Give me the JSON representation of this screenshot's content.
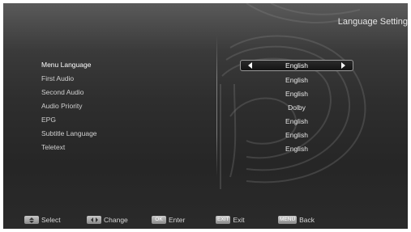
{
  "screen": {
    "title": "Language Setting"
  },
  "menu": {
    "items": [
      {
        "label": "Menu Language",
        "value": "English"
      },
      {
        "label": "First Audio",
        "value": "English"
      },
      {
        "label": "Second Audio",
        "value": "English"
      },
      {
        "label": "Audio Priority",
        "value": "Dolby"
      },
      {
        "label": "EPG",
        "value": "English"
      },
      {
        "label": "Subtitle Language",
        "value": "English"
      },
      {
        "label": "Teletext",
        "value": "English"
      }
    ],
    "selected_index": 0
  },
  "footer": {
    "select": {
      "label": "Select",
      "icon": "up-down-arrows-icon"
    },
    "change": {
      "label": "Change",
      "icon": "left-right-arrows-icon"
    },
    "enter": {
      "key": "OK",
      "label": "Enter"
    },
    "exit": {
      "key": "EXIT",
      "label": "Exit"
    },
    "back": {
      "key": "MENU",
      "label": "Back"
    }
  },
  "colors": {
    "background_top": "#5a5a5a",
    "background_bottom": "#262626",
    "text": "#e8e8e8",
    "key_button": "#a0a0a0"
  }
}
